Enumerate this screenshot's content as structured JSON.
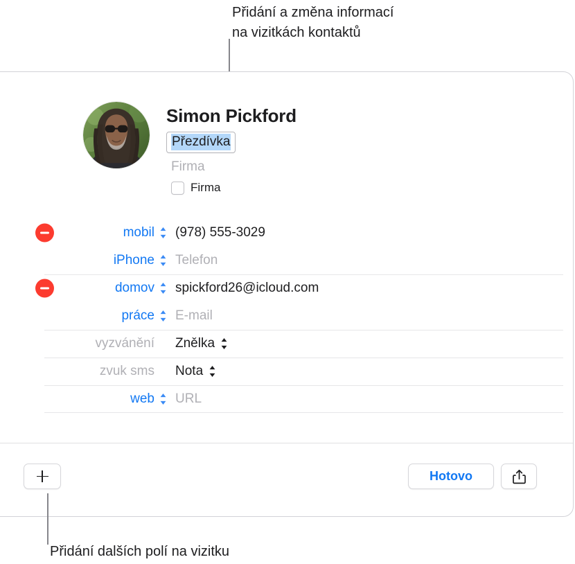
{
  "callouts": {
    "top": "Přidání a změna informací\nna vizitkách kontaktů",
    "bottom": "Přidání dalších polí na vizitku"
  },
  "identity": {
    "avatar_icon": "contact-photo",
    "name": "Simon  Pickford",
    "nickname_value": "Přezdívka",
    "company_placeholder": "Firma",
    "company_checkbox_label": "Firma",
    "company_checkbox_checked": false
  },
  "fields": [
    {
      "removable": true,
      "separator_above": false,
      "label": "mobil",
      "label_color": "blue",
      "label_stepper": true,
      "value": "(978) 555-3029",
      "value_is_placeholder": false,
      "value_stepper": false
    },
    {
      "removable": false,
      "separator_above": false,
      "label": "iPhone",
      "label_color": "blue",
      "label_stepper": true,
      "value": "Telefon",
      "value_is_placeholder": true,
      "value_stepper": false
    },
    {
      "removable": true,
      "separator_above": true,
      "label": "domov",
      "label_color": "blue",
      "label_stepper": true,
      "value": "spickford26@icloud.com",
      "value_is_placeholder": false,
      "value_stepper": false
    },
    {
      "removable": false,
      "separator_above": false,
      "label": "práce",
      "label_color": "blue",
      "label_stepper": true,
      "value": "E-mail",
      "value_is_placeholder": true,
      "value_stepper": false
    },
    {
      "removable": false,
      "separator_above": true,
      "label": "vyzvánění",
      "label_color": "gray",
      "label_stepper": false,
      "value": "Znělka",
      "value_is_placeholder": false,
      "value_stepper": true
    },
    {
      "removable": false,
      "separator_above": true,
      "label": "zvuk sms",
      "label_color": "gray",
      "label_stepper": false,
      "value": "Nota",
      "value_is_placeholder": false,
      "value_stepper": true
    },
    {
      "removable": false,
      "separator_above": true,
      "label": "web",
      "label_color": "blue",
      "label_stepper": true,
      "value": "URL",
      "value_is_placeholder": true,
      "value_stepper": false
    }
  ],
  "footer": {
    "add_button_icon": "plus-icon",
    "done_label": "Hotovo",
    "share_button_icon": "share-icon"
  },
  "colors": {
    "accent_blue": "#1278f3",
    "remove_red": "#fc3b2f",
    "selection_blue": "#b3d7f9",
    "placeholder_gray": "#b0b0b5",
    "card_border": "#d2d2d7",
    "leader_line": "#86868b"
  }
}
